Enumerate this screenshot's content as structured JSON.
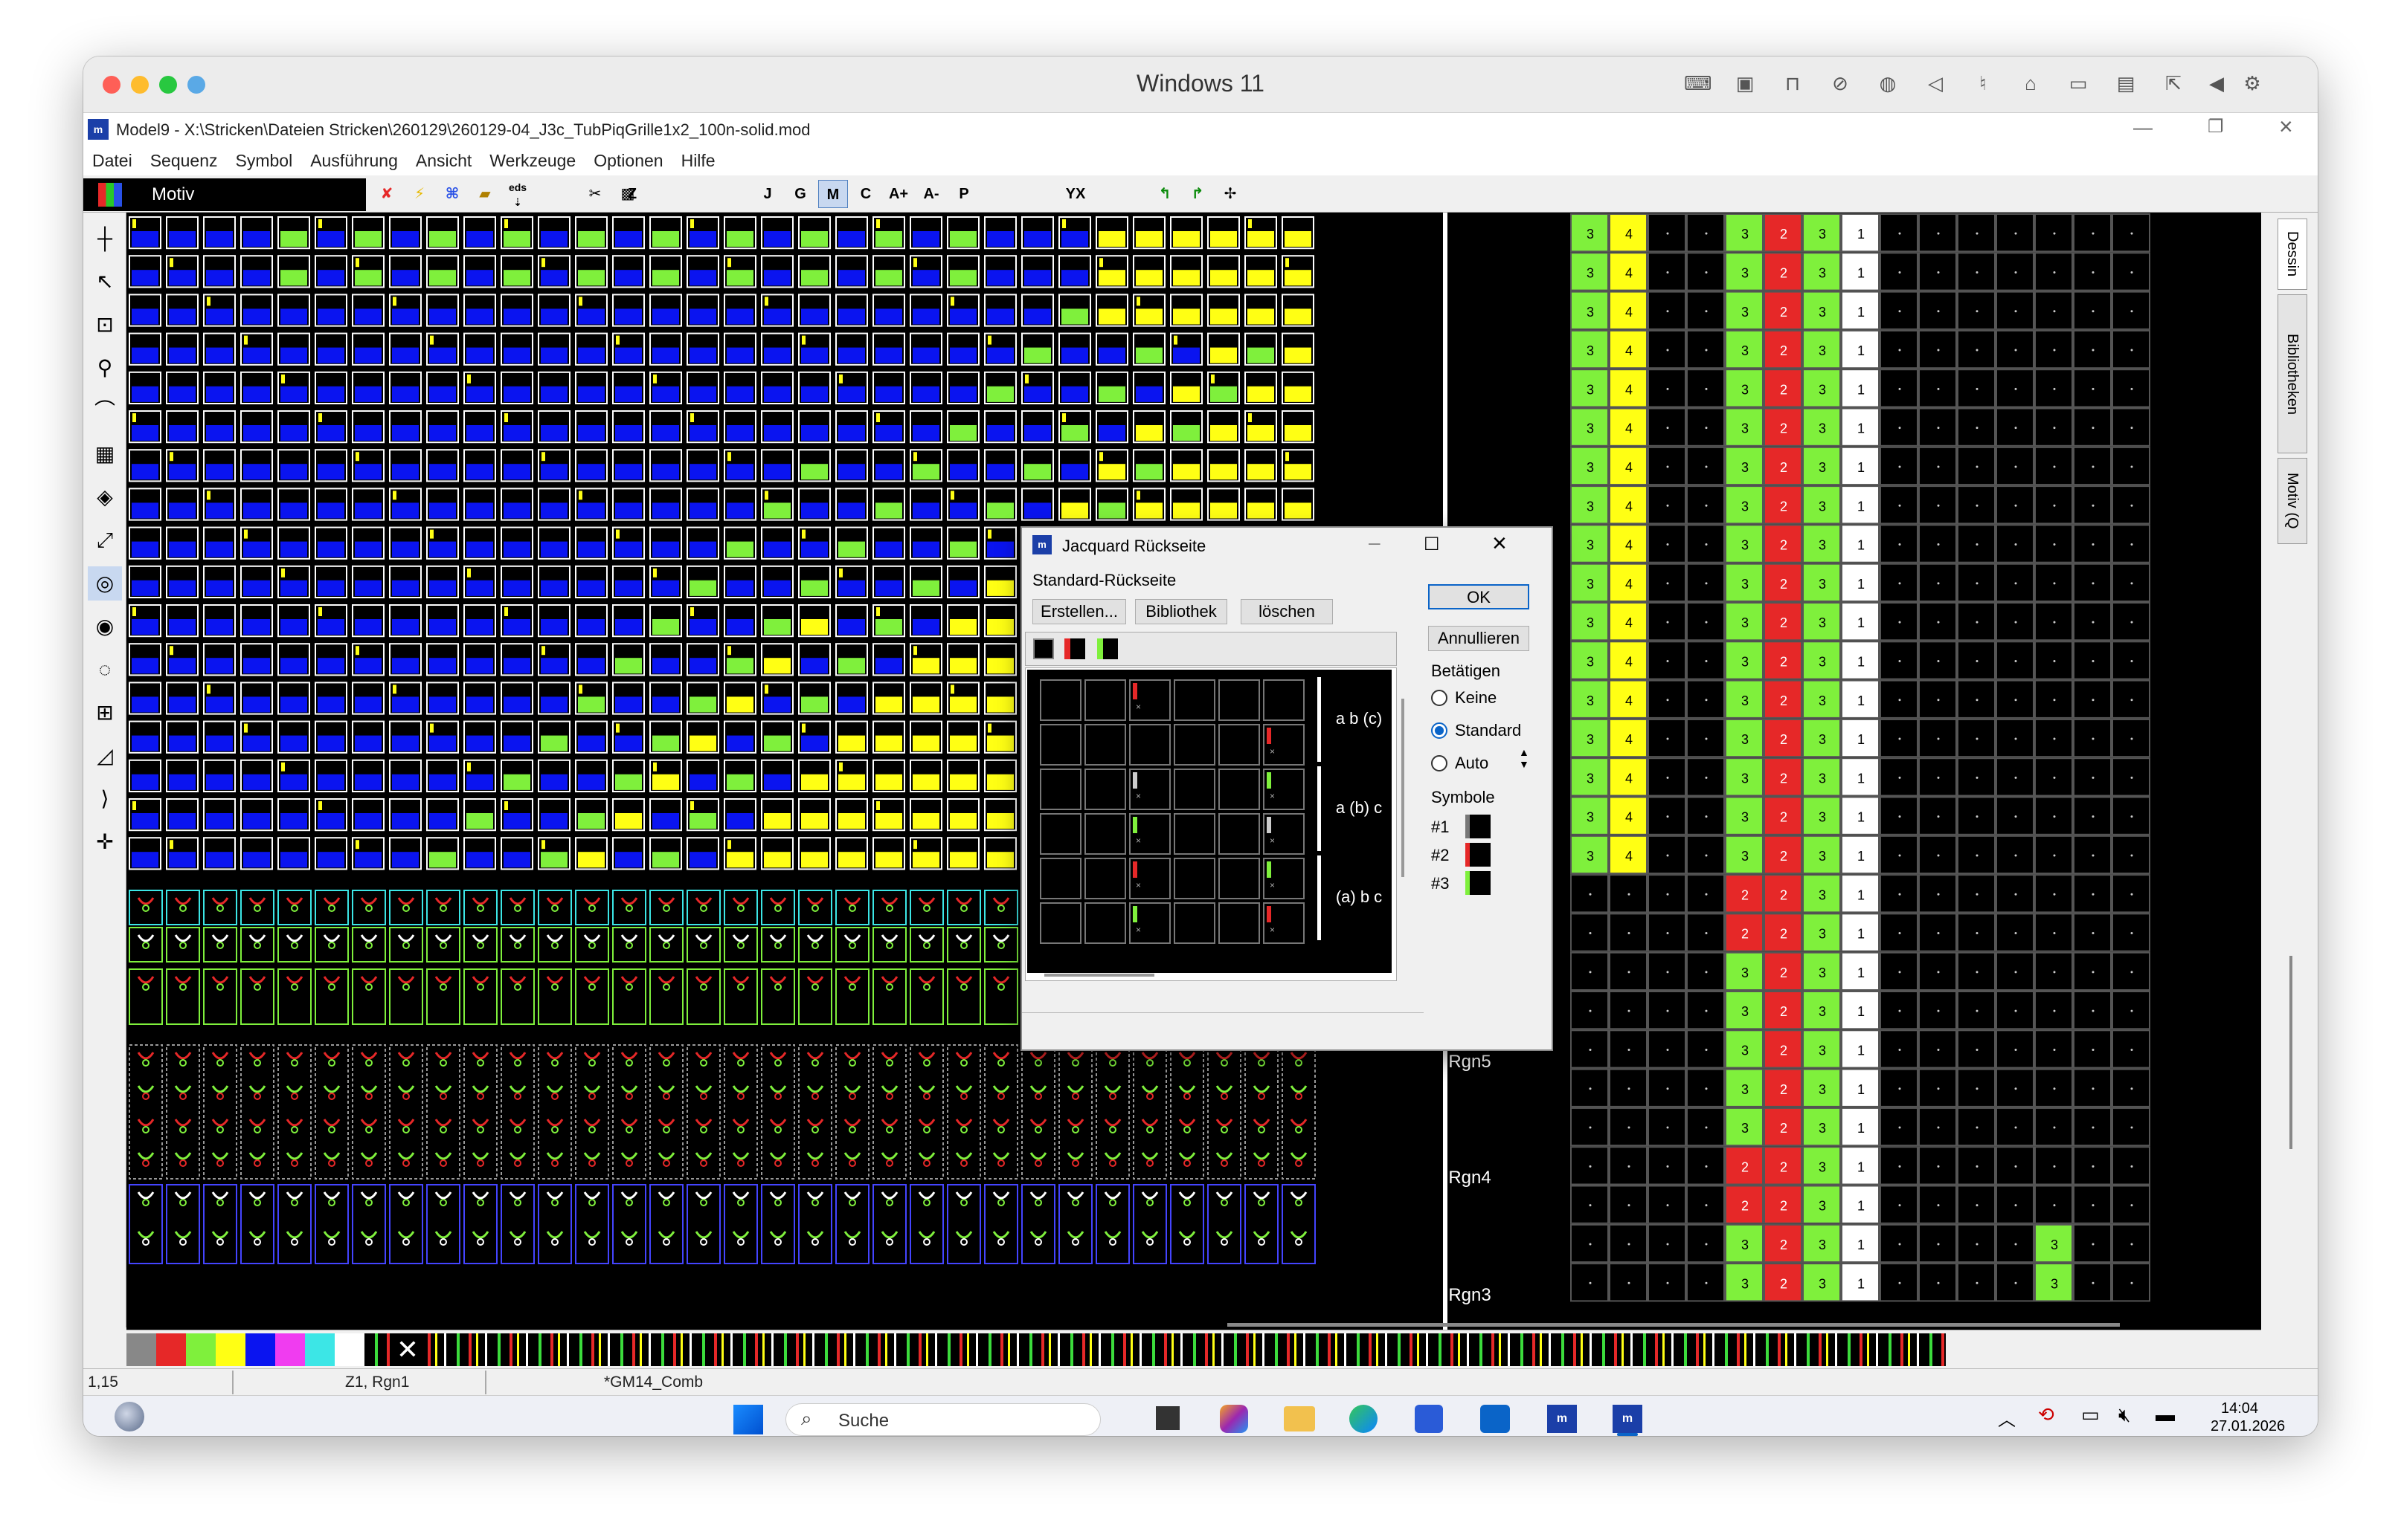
{
  "vm": {
    "title": "Windows 11"
  },
  "app": {
    "title": "Model9 - X:\\Stricken\\Dateien Stricken\\260129\\260129-04_J3c_TubPiqGrille1x2_100n-solid.mod"
  },
  "menu": [
    "Datei",
    "Sequenz",
    "Symbol",
    "Ausführung",
    "Ansicht",
    "Werkzeuge",
    "Optionen",
    "Hilfe"
  ],
  "toolbar": {
    "motiv_label": "Motiv",
    "eds_label": "eds",
    "text_buttons": [
      "Z",
      "J",
      "G",
      "M",
      "C",
      "A+",
      "A-",
      "P",
      "YX"
    ]
  },
  "side_tabs": [
    "Dessin",
    "Bibliotheken",
    "Motiv (Q"
  ],
  "regions": [
    "Rgn5",
    "Rgn4",
    "Rgn3"
  ],
  "grid": {
    "column_headers": [
      "3",
      "4",
      "3",
      "2",
      "3",
      "1"
    ],
    "dot": "·",
    "right_col_extra": "3"
  },
  "colors": {
    "blue": "#0a14f0",
    "yellow": "#ffff14",
    "green": "#7ff03c",
    "red": "#e62828",
    "cyan": "#3ce6e6",
    "white": "#ffffff",
    "black": "#000000",
    "gridline": "#555555"
  },
  "dialog": {
    "title": "Jacquard Rückseite",
    "section": "Standard-Rückseite",
    "buttons": {
      "create": "Erstellen...",
      "library": "Bibliothek",
      "delete": "löschen",
      "ok": "OK",
      "cancel": "Annullieren"
    },
    "betaetigen": {
      "label": "Betätigen",
      "options": [
        "Keine",
        "Standard",
        "Auto"
      ],
      "selected": "Standard"
    },
    "symbols": {
      "label": "Symbole",
      "items": [
        "#1",
        "#2",
        "#3"
      ]
    },
    "row_labels": [
      "a b (c)",
      "a (b) c",
      "(a) b c"
    ]
  },
  "status": {
    "coord": "1,15",
    "zone": "Z1, Rgn1",
    "comb": "*GM14_Comb"
  },
  "taskbar": {
    "search_placeholder": "Suche",
    "time": "14:04",
    "date": "27.01.2026"
  }
}
